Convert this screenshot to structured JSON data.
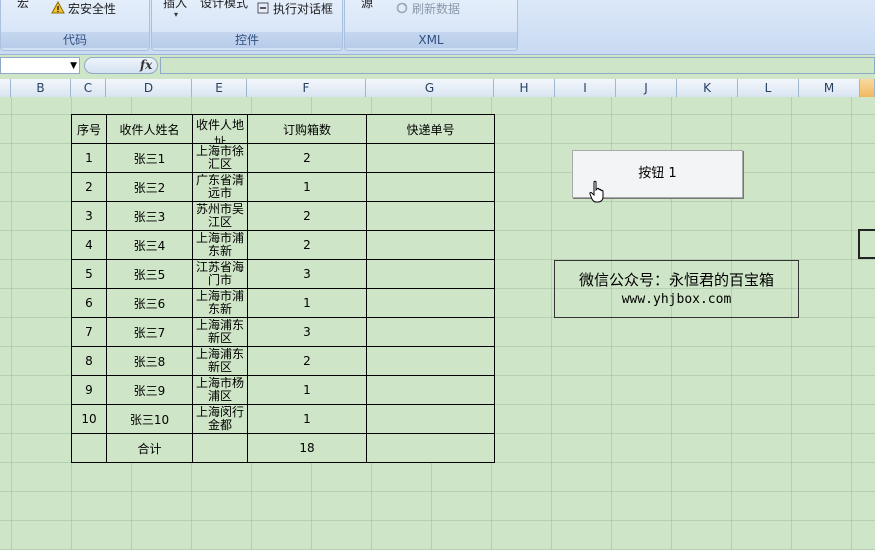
{
  "ribbon": {
    "code_group": {
      "label": "代码",
      "macro_partial": "宏",
      "security": "宏安全性"
    },
    "controls_group": {
      "label": "控件",
      "insert_partial": "插入",
      "design_mode_partial": "设计模式",
      "run_dialog": "执行对话框"
    },
    "xml_group": {
      "label": "XML",
      "source_partial": "源",
      "refresh_data": "刷新数据"
    }
  },
  "formula_bar": {
    "name_box": "",
    "fx": "fx",
    "content": ""
  },
  "columns": [
    "B",
    "C",
    "D",
    "E",
    "F",
    "G",
    "H",
    "I",
    "J",
    "K",
    "L",
    "M"
  ],
  "table": {
    "headers": [
      "序号",
      "收件人姓名",
      "收件人地址",
      "订购箱数",
      "快递单号"
    ],
    "rows": [
      {
        "no": "1",
        "name": "张三1",
        "addr": "上海市徐汇区",
        "qty": "2",
        "tracking": ""
      },
      {
        "no": "2",
        "name": "张三2",
        "addr": "广东省清远市",
        "qty": "1",
        "tracking": ""
      },
      {
        "no": "3",
        "name": "张三3",
        "addr": "苏州市吴江区",
        "qty": "2",
        "tracking": ""
      },
      {
        "no": "4",
        "name": "张三4",
        "addr": "上海市浦东新",
        "qty": "2",
        "tracking": ""
      },
      {
        "no": "5",
        "name": "张三5",
        "addr": "江苏省海门市",
        "qty": "3",
        "tracking": ""
      },
      {
        "no": "6",
        "name": "张三6",
        "addr": "上海市浦东新",
        "qty": "1",
        "tracking": ""
      },
      {
        "no": "7",
        "name": "张三7",
        "addr": "上海浦东新区",
        "qty": "3",
        "tracking": ""
      },
      {
        "no": "8",
        "name": "张三8",
        "addr": "上海浦东新区",
        "qty": "2",
        "tracking": ""
      },
      {
        "no": "9",
        "name": "张三9",
        "addr": "上海市杨浦区",
        "qty": "1",
        "tracking": ""
      },
      {
        "no": "10",
        "name": "张三10",
        "addr": "上海闵行金都",
        "qty": "1",
        "tracking": ""
      }
    ],
    "total": {
      "label": "合计",
      "qty": "18"
    }
  },
  "button1": {
    "label": "按钮 1"
  },
  "textbox": {
    "line1": "微信公众号：永恒君的百宝箱",
    "line2": "www.yhjbox.com"
  },
  "colors": {
    "sheet_bg": "#cfe5c7",
    "ribbon_bg": "#dbe8f8",
    "active_col": "#f1b95f"
  }
}
